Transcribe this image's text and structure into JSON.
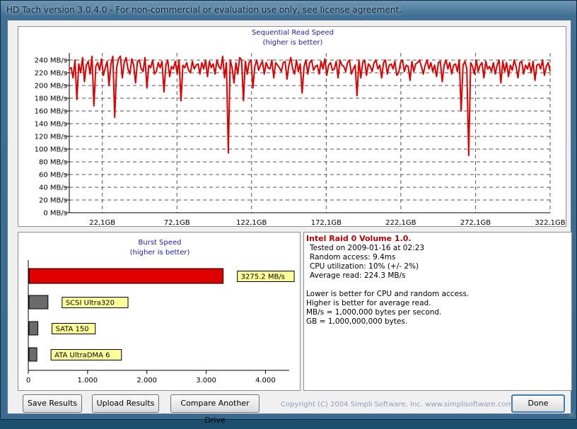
{
  "window": {
    "title": "HD Tach version 3.0.4.0  -  For non-commercial or evaluation use only, see license agreement."
  },
  "sequential_chart": {
    "title": "Sequential Read Speed",
    "subtitle": "(higher is better)"
  },
  "burst_chart": {
    "title": "Burst Speed",
    "subtitle": "(higher is better)"
  },
  "info": {
    "heading": "Intel Raid 0 Volume 1.0.",
    "tested": "Tested on 2009-01-16 at 02:23",
    "random_access": "Random access: 9.4ms",
    "cpu": "CPU utilization: 10% (+/- 2%)",
    "average_read": "Average read: 224.3 MB/s",
    "note1": "Lower is better for CPU and random access.",
    "note2": "Higher is better for average read.",
    "note3": "MB/s = 1,000,000 bytes per second.",
    "note4": "GB = 1,000,000,000 bytes."
  },
  "buttons": {
    "save": "Save Results",
    "upload": "Upload Results",
    "compare": "Compare Another Drive",
    "done": "Done"
  },
  "copyright": "Copyright (C) 2004 Simpli Software, Inc. www.simplisoftware.com",
  "colors": {
    "series": "#e00000",
    "burst_other": "#6b6b6b",
    "label_bg": "#ffff99",
    "title_blue": "#1b1bb8"
  },
  "chart_data": [
    {
      "type": "line",
      "title": "Sequential Read Speed",
      "subtitle": "(higher is better)",
      "ylim": [
        0,
        240
      ],
      "y_ticks": [
        "0 MB/s",
        "20 MB/s",
        "40 MB/s",
        "60 MB/s",
        "80 MB/s",
        "100 MB/s",
        "120 MB/s",
        "140 MB/s",
        "160 MB/s",
        "180 MB/s",
        "200 MB/s",
        "220 MB/s",
        "240 MB/s"
      ],
      "y_tick_values": [
        0,
        20,
        40,
        60,
        80,
        100,
        120,
        140,
        160,
        180,
        200,
        220,
        240
      ],
      "xlim": [
        0,
        322.1
      ],
      "x_ticks": [
        "22,1GB",
        "72,1GB",
        "122,1GB",
        "172,1GB",
        "222,1GB",
        "272,1GB",
        "322,1GB"
      ],
      "x_tick_values": [
        22.1,
        72.1,
        122.1,
        172.1,
        222.1,
        272.1,
        322.1
      ],
      "grid": true,
      "series": [
        {
          "values": [
            226,
            228,
            212,
            240,
            178,
            234,
            220,
            244,
            206,
            232,
            238,
            218,
            246,
            168,
            230,
            236,
            224,
            242,
            216,
            228,
            238,
            200,
            234,
            246,
            150,
            228,
            242,
            246,
            212,
            236,
            244,
            226,
            218,
            242,
            232,
            204,
            238,
            240,
            226,
            222,
            244,
            196,
            232,
            228,
            240,
            218,
            222,
            236,
            228,
            238,
            190,
            232,
            240,
            214,
            230,
            226,
            238,
            218,
            240,
            176,
            232,
            228,
            236,
            224,
            220,
            238,
            226,
            232,
            234,
            218,
            236,
            226,
            240,
            214,
            238,
            228,
            234,
            218,
            240,
            230,
            226,
            246,
            212,
            236,
            94,
            240,
            228,
            204,
            236,
            218,
            244,
            240,
            176,
            238,
            218,
            236,
            240,
            196,
            230,
            240,
            224,
            232,
            238,
            218,
            236,
            228,
            226,
            240,
            212,
            236,
            232,
            228,
            222,
            236,
            238,
            210,
            232,
            244,
            226,
            218,
            240,
            222,
            234,
            188,
            230,
            240,
            218,
            236,
            240,
            224,
            230,
            232,
            218,
            238,
            226,
            242,
            216,
            232,
            236,
            224,
            226,
            238,
            212,
            240,
            232,
            230,
            222,
            236,
            240,
            218,
            226,
            232,
            184,
            240,
            212,
            236,
            240,
            216,
            234,
            230,
            222,
            236,
            240,
            226,
            232,
            212,
            236,
            240,
            218,
            232,
            234,
            226,
            238,
            216,
            220,
            236,
            240,
            222,
            232,
            230,
            208,
            238,
            222,
            234,
            236,
            240,
            230,
            218,
            232,
            240,
            226,
            236,
            222,
            232,
            214,
            236,
            238,
            206,
            232,
            240,
            226,
            236,
            218,
            232,
            234,
            222,
            240,
            160,
            232,
            238,
            226,
            90,
            236,
            230,
            218,
            240,
            222,
            232,
            236,
            212,
            238,
            226,
            230,
            222,
            236,
            218,
            232,
            240,
            204,
            238,
            222,
            236,
            214,
            232,
            224,
            240,
            230,
            212,
            236,
            238,
            218,
            232,
            226,
            236,
            220,
            238,
            208,
            232,
            234,
            226,
            240,
            216,
            230,
            236,
            222
          ]
        }
      ]
    },
    {
      "type": "bar",
      "orientation": "horizontal",
      "title": "Burst Speed",
      "subtitle": "(higher is better)",
      "categories": [
        "3275.2 MB/s",
        "SCSI Ultra320",
        "SATA 150",
        "ATA UltraDMA 6"
      ],
      "values": [
        3275.2,
        320,
        150,
        133
      ],
      "xlim": [
        0,
        4400
      ],
      "x_ticks": [
        "0",
        "1.000",
        "2.000",
        "3.000",
        "4.000"
      ],
      "x_tick_values": [
        0,
        1000,
        2000,
        3000,
        4000
      ],
      "grid": false
    }
  ]
}
